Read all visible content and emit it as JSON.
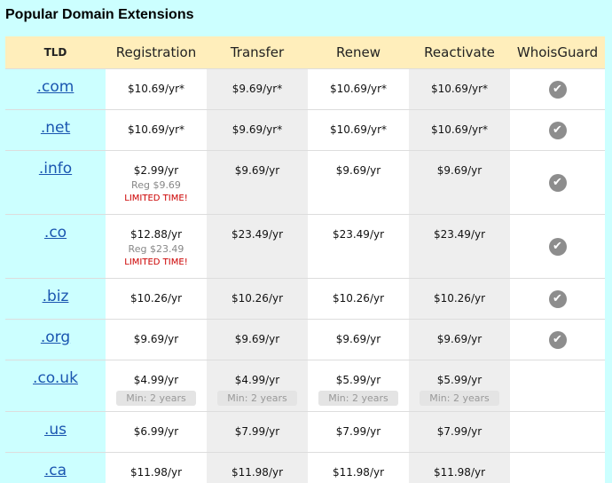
{
  "title": "Popular Domain Extensions",
  "headers": {
    "tld": "TLD",
    "registration": "Registration",
    "transfer": "Transfer",
    "renew": "Renew",
    "reactivate": "Reactivate",
    "whoisguard": "WhoisGuard"
  },
  "icons": {
    "whoisguard_included": "check-circle-icon"
  },
  "colors": {
    "page_bg": "#ccffff",
    "header_bg": "#ffeebb",
    "link": "#1a56b0",
    "limited": "#cc0000"
  },
  "rows": [
    {
      "tld": ".com",
      "registration": "$10.69/yr*",
      "transfer": "$9.69/yr*",
      "renew": "$10.69/yr*",
      "reactivate": "$10.69/yr*",
      "whoisguard": true
    },
    {
      "tld": ".net",
      "registration": "$10.69/yr*",
      "transfer": "$9.69/yr*",
      "renew": "$10.69/yr*",
      "reactivate": "$10.69/yr*",
      "whoisguard": true
    },
    {
      "tld": ".info",
      "registration": "$2.99/yr",
      "reg_regular": "Reg $9.69",
      "promo": "LIMITED TIME!",
      "transfer": "$9.69/yr",
      "renew": "$9.69/yr",
      "reactivate": "$9.69/yr",
      "whoisguard": true
    },
    {
      "tld": ".co",
      "registration": "$12.88/yr",
      "reg_regular": "Reg $23.49",
      "promo": "LIMITED TIME!",
      "transfer": "$23.49/yr",
      "renew": "$23.49/yr",
      "reactivate": "$23.49/yr",
      "whoisguard": true
    },
    {
      "tld": ".biz",
      "registration": "$10.26/yr",
      "transfer": "$10.26/yr",
      "renew": "$10.26/yr",
      "reactivate": "$10.26/yr",
      "whoisguard": true
    },
    {
      "tld": ".org",
      "registration": "$9.69/yr",
      "transfer": "$9.69/yr",
      "renew": "$9.69/yr",
      "reactivate": "$9.69/yr",
      "whoisguard": true
    },
    {
      "tld": ".co.uk",
      "registration": "$4.99/yr",
      "transfer": "$4.99/yr",
      "renew": "$5.99/yr",
      "reactivate": "$5.99/yr",
      "min_term": "Min: 2 years",
      "whoisguard": false
    },
    {
      "tld": ".us",
      "registration": "$6.99/yr",
      "transfer": "$7.99/yr",
      "renew": "$7.99/yr",
      "reactivate": "$7.99/yr",
      "whoisguard": false
    },
    {
      "tld": ".ca",
      "registration": "$11.98/yr",
      "transfer": "$11.98/yr",
      "renew": "$11.98/yr",
      "reactivate": "$11.98/yr",
      "whoisguard": false
    }
  ]
}
